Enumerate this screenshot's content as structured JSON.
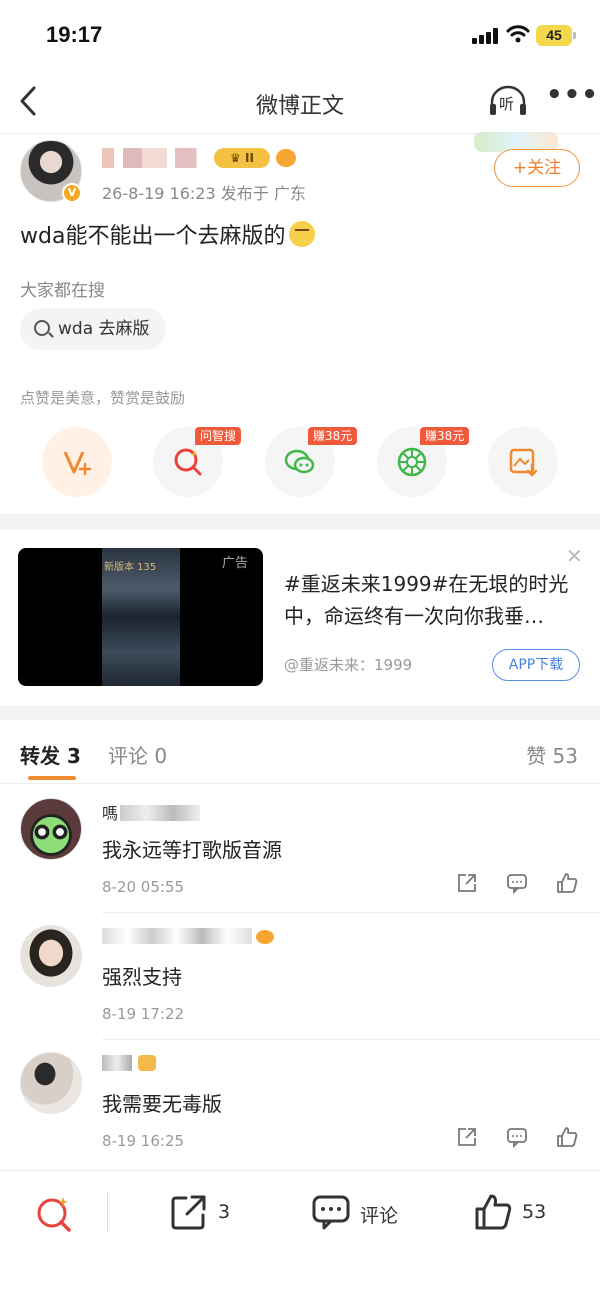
{
  "status_bar": {
    "time": "19:17",
    "battery": "45"
  },
  "nav": {
    "title": "微博正文",
    "listen_label": "听"
  },
  "post": {
    "meta": "26-8-19 16:23  发布于 广东",
    "crown_badge": "II",
    "follow_label": "+关注",
    "text": "wda能不能出一个去麻版的",
    "hot_search_label": "大家都在搜",
    "search_chip": "wda 去麻版",
    "reward_hint": "点赞是美意，赞赏是鼓励",
    "actions": [
      {
        "icon": "reward-v-icon",
        "tag": ""
      },
      {
        "icon": "ask-search-icon",
        "tag": "问智搜"
      },
      {
        "icon": "wechat-icon",
        "tag": "赚38元"
      },
      {
        "icon": "moments-icon",
        "tag": "赚38元"
      },
      {
        "icon": "save-image-icon",
        "tag": ""
      }
    ]
  },
  "ad": {
    "label": "广告",
    "title": "#重返未来1999#在无垠的时光中，命运终有一次向你我垂…",
    "source": "@重返未来：1999",
    "download_label": "APP下载",
    "poster_text": "新版本 135"
  },
  "tabs": {
    "repost": "转发 3",
    "comment": "评论 0",
    "like": "赞 53"
  },
  "comments": [
    {
      "name": "嗎",
      "text": "我永远等打歌版音源",
      "time": "8-20 05:55"
    },
    {
      "name": "",
      "text": "强烈支持",
      "time": "8-19 17:22"
    },
    {
      "name": "",
      "text": "我需要无毒版",
      "time": "8-19 16:25"
    }
  ],
  "bottom_bar": {
    "repost_count": "3",
    "comment_label": "评论",
    "like_count": "53"
  },
  "colors": {
    "accent_orange": "#f08030",
    "tag_red": "#f05a3b",
    "link_blue": "#4a7edc"
  }
}
